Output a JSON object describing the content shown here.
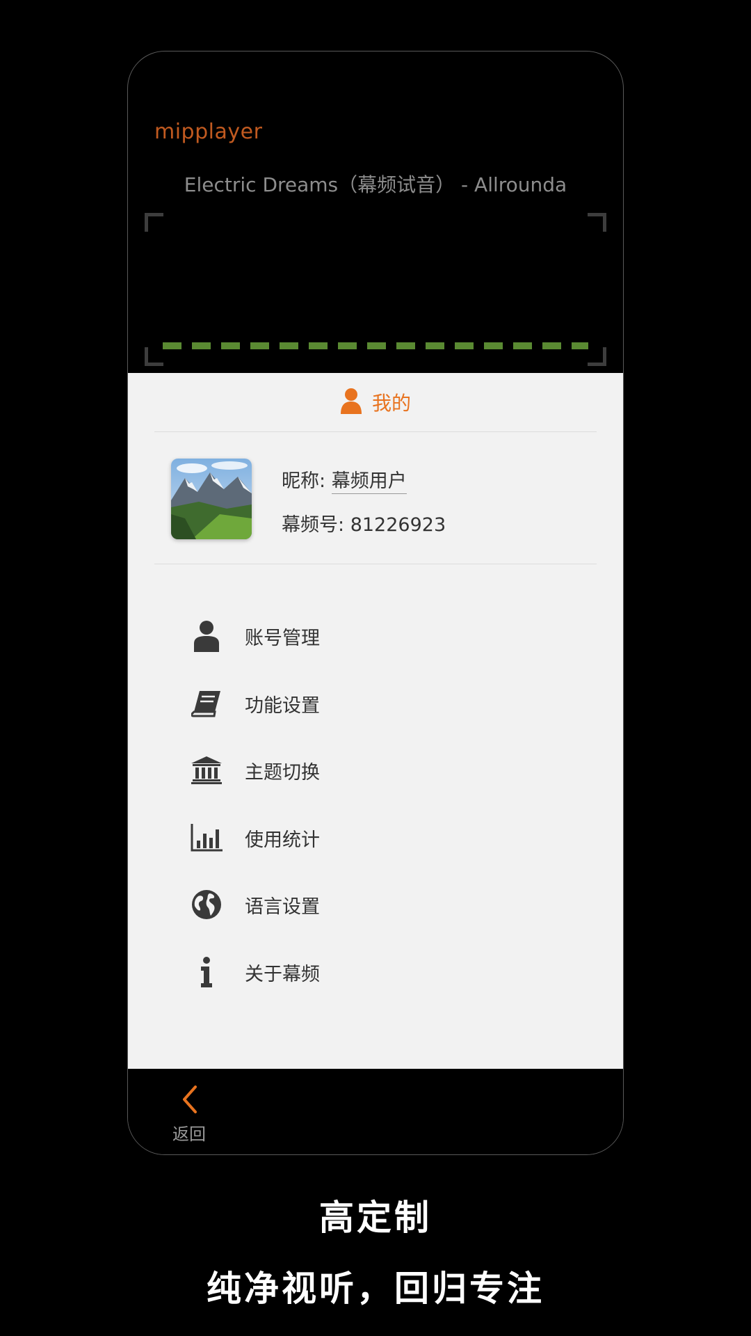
{
  "player": {
    "app_name": "mipplayer",
    "song_title": "Electric Dreams（幕频试音） - Allrounda",
    "accent_color": "#5a8a32"
  },
  "panel": {
    "title": "我的",
    "title_icon": "person-icon",
    "accent_color": "#e8731f",
    "profile": {
      "nickname_label": "昵称:",
      "nickname_value": "幕频用户",
      "id_label": "幕频号:",
      "id_value": "81226923",
      "avatar": "mountain-landscape-avatar"
    },
    "menu": [
      {
        "label": "账号管理",
        "icon": "user-icon"
      },
      {
        "label": "功能设置",
        "icon": "book-icon"
      },
      {
        "label": "主题切换",
        "icon": "bank-icon"
      },
      {
        "label": "使用统计",
        "icon": "bar-chart-icon"
      },
      {
        "label": "语言设置",
        "icon": "globe-icon"
      },
      {
        "label": "关于幕频",
        "icon": "info-icon"
      }
    ]
  },
  "bottom_bar": {
    "back_label": "返回",
    "back_icon": "chevron-left-icon"
  },
  "captions": {
    "line1": "高定制",
    "line2": "纯净视听，回归专注"
  }
}
